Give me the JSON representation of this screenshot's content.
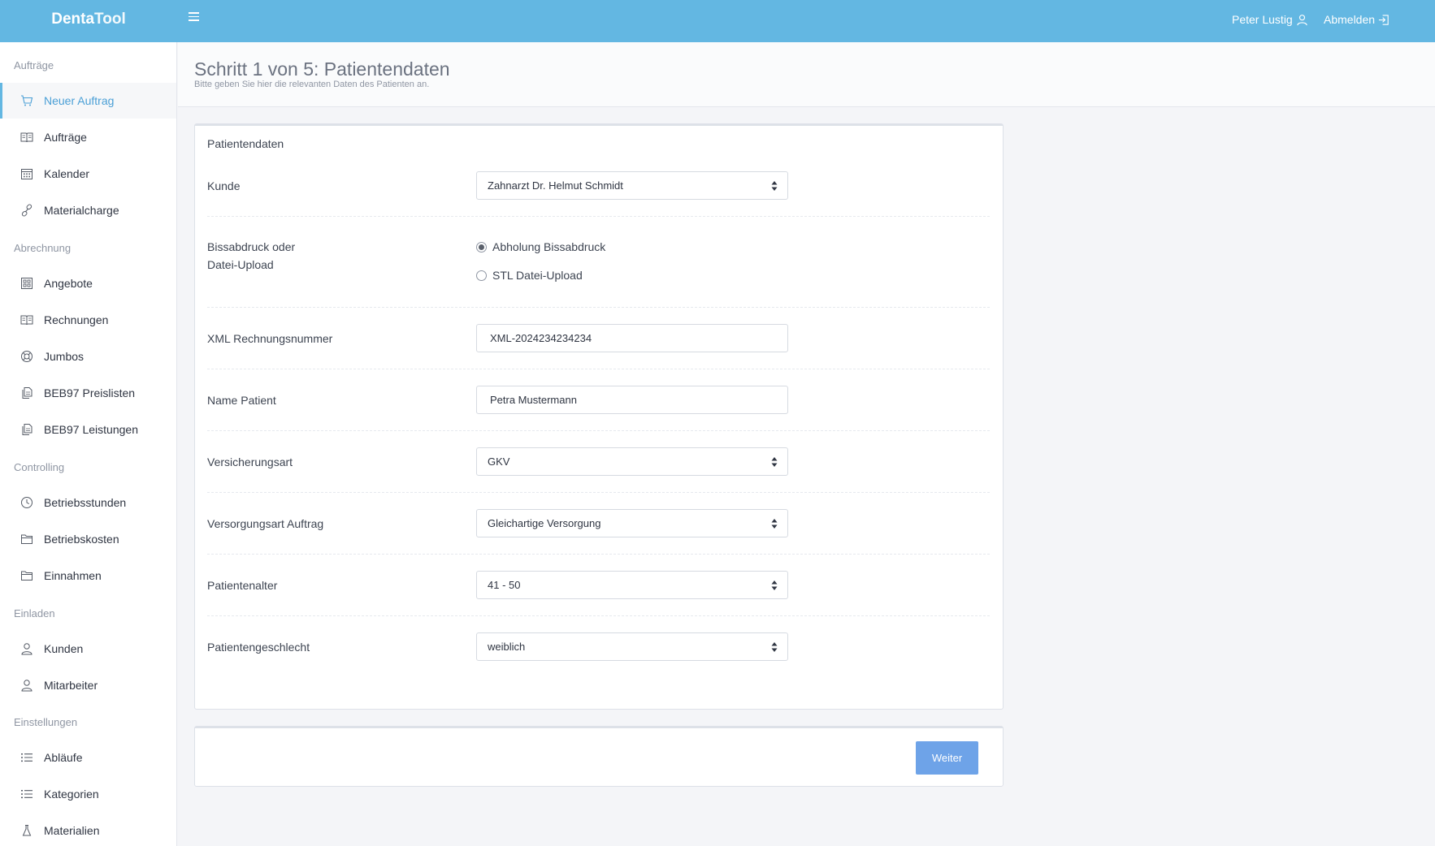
{
  "header": {
    "brand_bold": "Denta",
    "brand_light": "Tool",
    "user_name": "Peter Lustig",
    "logout_label": "Abmelden"
  },
  "sidebar": {
    "sections": [
      {
        "title": "Aufträge",
        "items": [
          {
            "label": "Neuer Auftrag",
            "icon": "cart-icon",
            "active": true
          },
          {
            "label": "Aufträge",
            "icon": "book-icon"
          },
          {
            "label": "Kalender",
            "icon": "calendar-icon"
          },
          {
            "label": "Materialcharge",
            "icon": "link-icon"
          }
        ]
      },
      {
        "title": "Abrechnung",
        "items": [
          {
            "label": "Angebote",
            "icon": "grid-icon"
          },
          {
            "label": "Rechnungen",
            "icon": "book-icon"
          },
          {
            "label": "Jumbos",
            "icon": "lifebuoy-icon"
          },
          {
            "label": "BEB97 Preislisten",
            "icon": "documents-icon"
          },
          {
            "label": "BEB97 Leistungen",
            "icon": "documents-icon"
          }
        ]
      },
      {
        "title": "Controlling",
        "items": [
          {
            "label": "Betriebsstunden",
            "icon": "clock-icon"
          },
          {
            "label": "Betriebskosten",
            "icon": "folder-icon"
          },
          {
            "label": "Einnahmen",
            "icon": "folder-icon"
          }
        ]
      },
      {
        "title": "Einladen",
        "items": [
          {
            "label": "Kunden",
            "icon": "user-icon"
          },
          {
            "label": "Mitarbeiter",
            "icon": "user-icon"
          }
        ]
      },
      {
        "title": "Einstellungen",
        "items": [
          {
            "label": "Abläufe",
            "icon": "list-icon"
          },
          {
            "label": "Kategorien",
            "icon": "list-icon"
          },
          {
            "label": "Materialien",
            "icon": "flask-icon"
          }
        ]
      }
    ]
  },
  "page": {
    "title": "Schritt 1 von 5: Patientendaten",
    "subtitle": "Bitte geben Sie hier die relevanten Daten des Patienten an."
  },
  "form": {
    "card_title": "Patientendaten",
    "kunde": {
      "label": "Kunde",
      "value": "Zahnarzt Dr. Helmut Schmidt"
    },
    "bissabdruck": {
      "label_line1": "Bissabdruck oder",
      "label_line2": "Datei-Upload",
      "options": [
        {
          "label": "Abholung Bissabdruck",
          "checked": true
        },
        {
          "label": "STL Datei-Upload",
          "checked": false
        }
      ]
    },
    "xml": {
      "label": "XML Rechnungsnummer",
      "value": "XML-2024234234234"
    },
    "name": {
      "label": "Name Patient",
      "value": "Petra Mustermann"
    },
    "versicherung": {
      "label": "Versicherungsart",
      "value": "GKV"
    },
    "versorgung": {
      "label": "Versorgungsart Auftrag",
      "value": "Gleichartige Versorgung"
    },
    "alter": {
      "label": "Patientenalter",
      "value": "41 - 50"
    },
    "geschlecht": {
      "label": "Patientengeschlecht",
      "value": "weiblich"
    }
  },
  "footer": {
    "next_label": "Weiter"
  },
  "colors": {
    "header": "#63b7e2",
    "accent": "#4a9fd6",
    "button": "#6ea3e8"
  }
}
